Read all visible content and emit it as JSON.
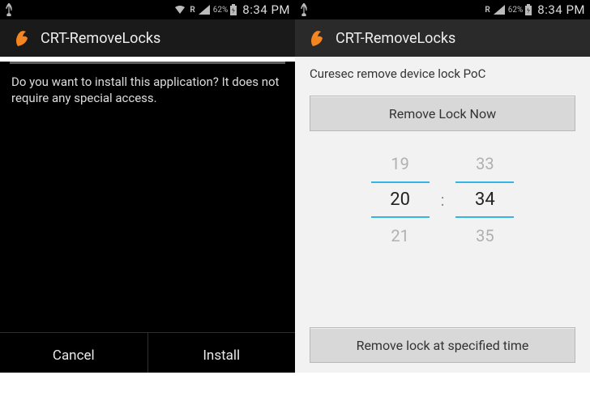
{
  "status": {
    "battery": "62%",
    "roaming": "R",
    "time": "8:34 PM"
  },
  "left": {
    "title": "CRT-RemoveLocks",
    "message": "Do you want to install this application? It does not require any special access.",
    "cancel": "Cancel",
    "install": "Install"
  },
  "right": {
    "title": "CRT-RemoveLocks",
    "poc_label": "Curesec remove device lock PoC",
    "remove_now": "Remove Lock Now",
    "picker": {
      "hour_prev": "19",
      "hour": "20",
      "hour_next": "21",
      "min_prev": "33",
      "min": "34",
      "min_next": "35",
      "colon": ":"
    },
    "remove_at": "Remove lock at specified time"
  }
}
